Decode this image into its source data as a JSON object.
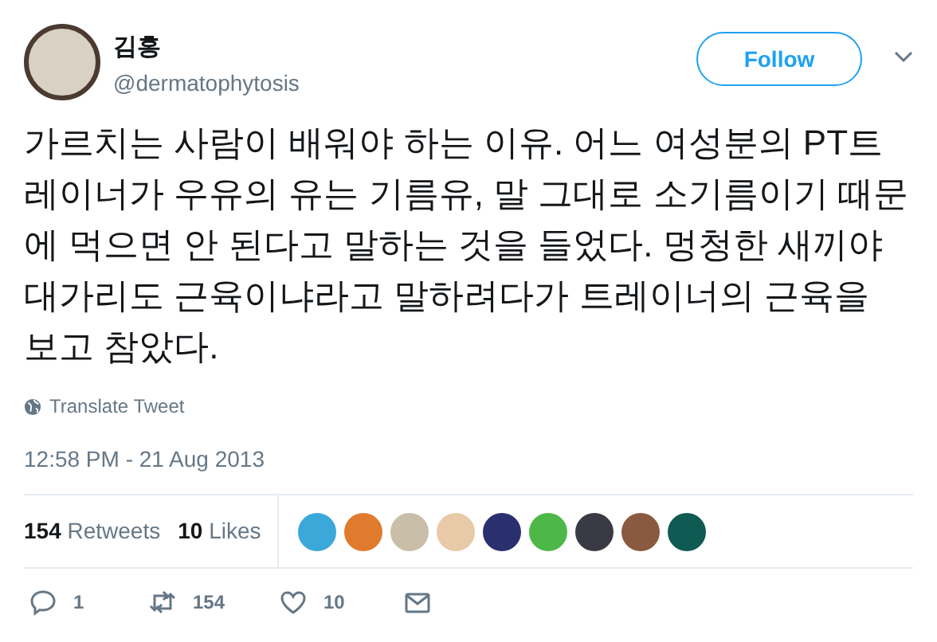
{
  "author": {
    "name": "김홍",
    "handle": "@dermatophytosis"
  },
  "follow_button": {
    "label": "Follow"
  },
  "tweet_text": "가르치는 사람이 배워야 하는 이유. 어느 여성분의 PT트레이너가 우유의 유는 기름유, 말 그대로 소기름이기 때문에 먹으면 안 된다고 말하는 것을 들었다. 멍청한 새끼야 대가리도 근육이냐라고 말하려다가 트레이너의 근육을 보고 참았다.",
  "translate_link": "Translate Tweet",
  "timestamp": "12:58 PM - 21 Aug 2013",
  "stats": [
    {
      "count": "154",
      "label": "Retweets"
    },
    {
      "count": "10",
      "label": "Likes"
    }
  ],
  "likers": [
    {
      "color": "#3aa8d8"
    },
    {
      "color": "#e07a2c"
    },
    {
      "color": "#c9bfa8"
    },
    {
      "color": "#e8c9a8"
    },
    {
      "color": "#2a2f6e"
    },
    {
      "color": "#4db848"
    },
    {
      "color": "#3a3a44"
    },
    {
      "color": "#8a5a40"
    },
    {
      "color": "#0f5a52"
    }
  ],
  "actions": [
    {
      "kind": "reply",
      "count": "1"
    },
    {
      "kind": "retweet",
      "count": "154"
    },
    {
      "kind": "like",
      "count": "10"
    },
    {
      "kind": "message"
    }
  ]
}
